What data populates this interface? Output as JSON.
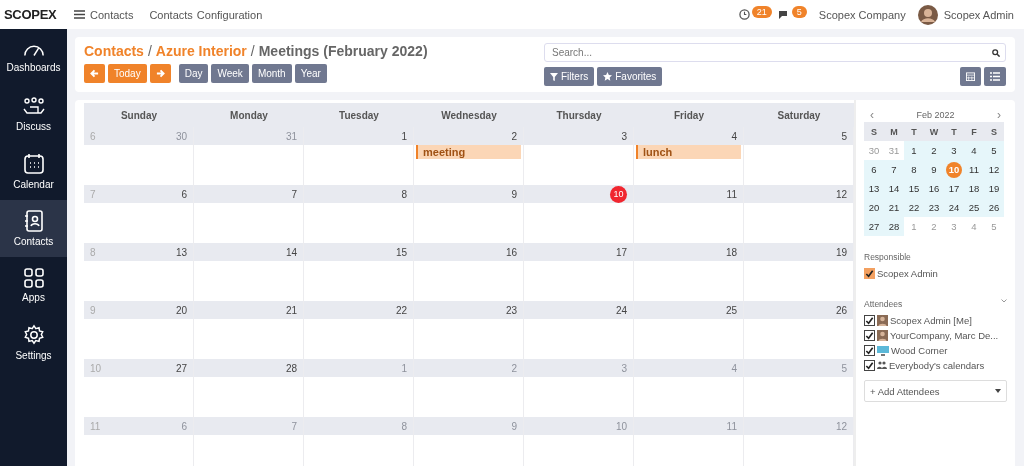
{
  "topbar": {
    "logo": "SCOPEX",
    "app_name": "Contacts",
    "menu": [
      "Contacts",
      "Configuration"
    ],
    "activity_count": "21",
    "message_count": "5",
    "company": "Scopex Company",
    "user": "Scopex Admin"
  },
  "sidebar": {
    "items": [
      {
        "label": "Dashboards",
        "selected": false
      },
      {
        "label": "Discuss",
        "selected": false
      },
      {
        "label": "Calendar",
        "selected": false
      },
      {
        "label": "Contacts",
        "selected": true
      },
      {
        "label": "Apps",
        "selected": false
      },
      {
        "label": "Settings",
        "selected": false
      }
    ]
  },
  "breadcrumb": [
    "Contacts",
    "/",
    "Azure Interior",
    "/",
    "Meetings (February 2022)"
  ],
  "nav_buttons": [
    {
      "kind": "prev"
    },
    {
      "kind": "today",
      "label": "Today"
    },
    {
      "kind": "next"
    }
  ],
  "scale_buttons": [
    "Day",
    "Week",
    "Month",
    "Year"
  ],
  "search": {
    "placeholder": "Search..."
  },
  "filter_buttons": [
    {
      "kind": "filter",
      "label": "Filters"
    },
    {
      "kind": "star",
      "label": "Favorites"
    }
  ],
  "calendar": {
    "weekdays": [
      "Sunday",
      "Monday",
      "Tuesday",
      "Wednesday",
      "Thursday",
      "Friday",
      "Saturday"
    ],
    "weeks": [
      {
        "number": "6",
        "days": [
          {
            "date": "30",
            "outside": true,
            "today": false
          },
          {
            "date": "31",
            "outside": true,
            "today": false
          },
          {
            "date": "1",
            "outside": false,
            "today": false
          },
          {
            "date": "2",
            "outside": false,
            "today": false,
            "events": [
              "meeting"
            ]
          },
          {
            "date": "3",
            "outside": false,
            "today": false
          },
          {
            "date": "4",
            "outside": false,
            "today": false,
            "events": [
              "lunch"
            ]
          },
          {
            "date": "5",
            "outside": false,
            "today": false
          }
        ]
      },
      {
        "number": "7",
        "days": [
          {
            "date": "6",
            "outside": false,
            "today": false
          },
          {
            "date": "7",
            "outside": false,
            "today": false
          },
          {
            "date": "8",
            "outside": false,
            "today": false
          },
          {
            "date": "9",
            "outside": false,
            "today": false
          },
          {
            "date": "10",
            "outside": false,
            "today": true
          },
          {
            "date": "11",
            "outside": false,
            "today": false
          },
          {
            "date": "12",
            "outside": false,
            "today": false
          }
        ]
      },
      {
        "number": "8",
        "days": [
          {
            "date": "13",
            "outside": false,
            "today": false
          },
          {
            "date": "14",
            "outside": false,
            "today": false
          },
          {
            "date": "15",
            "outside": false,
            "today": false
          },
          {
            "date": "16",
            "outside": false,
            "today": false
          },
          {
            "date": "17",
            "outside": false,
            "today": false
          },
          {
            "date": "18",
            "outside": false,
            "today": false
          },
          {
            "date": "19",
            "outside": false,
            "today": false
          }
        ]
      },
      {
        "number": "9",
        "days": [
          {
            "date": "20",
            "outside": false,
            "today": false
          },
          {
            "date": "21",
            "outside": false,
            "today": false
          },
          {
            "date": "22",
            "outside": false,
            "today": false
          },
          {
            "date": "23",
            "outside": false,
            "today": false
          },
          {
            "date": "24",
            "outside": false,
            "today": false
          },
          {
            "date": "25",
            "outside": false,
            "today": false
          },
          {
            "date": "26",
            "outside": false,
            "today": false
          }
        ]
      },
      {
        "number": "10",
        "days": [
          {
            "date": "27",
            "outside": false,
            "today": false
          },
          {
            "date": "28",
            "outside": false,
            "today": false
          },
          {
            "date": "1",
            "outside": true,
            "today": false
          },
          {
            "date": "2",
            "outside": true,
            "today": false
          },
          {
            "date": "3",
            "outside": true,
            "today": false
          },
          {
            "date": "4",
            "outside": true,
            "today": false
          },
          {
            "date": "5",
            "outside": true,
            "today": false
          }
        ]
      },
      {
        "number": "11",
        "days": [
          {
            "date": "6",
            "outside": true,
            "today": false
          },
          {
            "date": "7",
            "outside": true,
            "today": false
          },
          {
            "date": "8",
            "outside": true,
            "today": false
          },
          {
            "date": "9",
            "outside": true,
            "today": false
          },
          {
            "date": "10",
            "outside": true,
            "today": false
          },
          {
            "date": "11",
            "outside": true,
            "today": false
          },
          {
            "date": "12",
            "outside": true,
            "today": false
          }
        ]
      }
    ]
  },
  "mini_calendar": {
    "prev": "‹",
    "title": "Feb 2022",
    "next": "›",
    "weekdays": [
      "S",
      "M",
      "T",
      "W",
      "T",
      "F",
      "S"
    ],
    "weeks": [
      [
        {
          "date": "30",
          "outside": true,
          "today": false
        },
        {
          "date": "31",
          "outside": true,
          "today": false
        },
        {
          "date": "1",
          "outside": false,
          "today": false
        },
        {
          "date": "2",
          "outside": false,
          "today": false
        },
        {
          "date": "3",
          "outside": false,
          "today": false
        },
        {
          "date": "4",
          "outside": false,
          "today": false
        },
        {
          "date": "5",
          "outside": false,
          "today": false
        }
      ],
      [
        {
          "date": "6",
          "outside": false,
          "today": false
        },
        {
          "date": "7",
          "outside": false,
          "today": false
        },
        {
          "date": "8",
          "outside": false,
          "today": false
        },
        {
          "date": "9",
          "outside": false,
          "today": false
        },
        {
          "date": "10",
          "outside": false,
          "today": true
        },
        {
          "date": "11",
          "outside": false,
          "today": false
        },
        {
          "date": "12",
          "outside": false,
          "today": false
        }
      ],
      [
        {
          "date": "13",
          "outside": false,
          "today": false
        },
        {
          "date": "14",
          "outside": false,
          "today": false
        },
        {
          "date": "15",
          "outside": false,
          "today": false
        },
        {
          "date": "16",
          "outside": false,
          "today": false
        },
        {
          "date": "17",
          "outside": false,
          "today": false
        },
        {
          "date": "18",
          "outside": false,
          "today": false
        },
        {
          "date": "19",
          "outside": false,
          "today": false
        }
      ],
      [
        {
          "date": "20",
          "outside": false,
          "today": false
        },
        {
          "date": "21",
          "outside": false,
          "today": false
        },
        {
          "date": "22",
          "outside": false,
          "today": false
        },
        {
          "date": "23",
          "outside": false,
          "today": false
        },
        {
          "date": "24",
          "outside": false,
          "today": false
        },
        {
          "date": "25",
          "outside": false,
          "today": false
        },
        {
          "date": "26",
          "outside": false,
          "today": false
        }
      ],
      [
        {
          "date": "27",
          "outside": false,
          "today": false
        },
        {
          "date": "28",
          "outside": false,
          "today": false
        },
        {
          "date": "1",
          "outside": true,
          "today": false
        },
        {
          "date": "2",
          "outside": true,
          "today": false
        },
        {
          "date": "3",
          "outside": true,
          "today": false
        },
        {
          "date": "4",
          "outside": true,
          "today": false
        },
        {
          "date": "5",
          "outside": true,
          "today": false
        }
      ]
    ]
  },
  "responsible": {
    "label": "Responsible",
    "items": [
      {
        "name": "Scopex Admin",
        "checked": true
      }
    ]
  },
  "attendees": {
    "label": "Attendees",
    "items": [
      {
        "kind": "person",
        "name": "Scopex Admin [Me]",
        "checked": true
      },
      {
        "kind": "person",
        "name": "YourCompany, Marc De...",
        "checked": true
      },
      {
        "kind": "company",
        "name": "Wood Corner",
        "checked": true
      },
      {
        "kind": "group",
        "name": "Everybody's calendars",
        "checked": true
      }
    ],
    "add_placeholder": "+ Add Attendees"
  }
}
